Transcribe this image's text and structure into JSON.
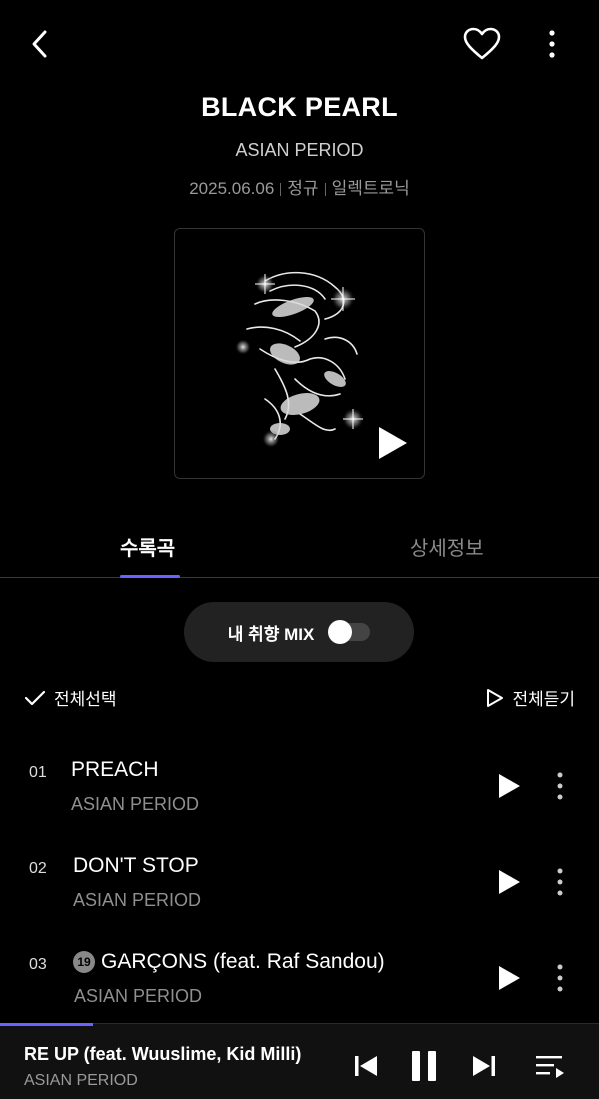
{
  "header": {
    "back_icon": "chevron-left-icon",
    "like_icon": "heart-outline-icon",
    "more_icon": "more-vertical-icon"
  },
  "album": {
    "title": "BLACK PEARL",
    "artist": "ASIAN PERIOD",
    "date": "2025.06.06",
    "type": "정규",
    "genre": "일렉트로닉"
  },
  "tabs": [
    {
      "label": "수록곡",
      "active": true
    },
    {
      "label": "상세정보",
      "active": false
    }
  ],
  "mix": {
    "label": "내 취향 MIX",
    "enabled": false
  },
  "list_controls": {
    "select_all": "전체선택",
    "play_all": "전체듣기"
  },
  "tracks": [
    {
      "num": "01",
      "title": "PREACH",
      "artist": "ASIAN PERIOD",
      "explicit": false
    },
    {
      "num": "02",
      "title": "DON'T STOP",
      "artist": "ASIAN PERIOD",
      "explicit": false
    },
    {
      "num": "03",
      "title": "GARÇONS (feat. Raf Sandou)",
      "artist": "ASIAN PERIOD",
      "explicit": true,
      "badge": "19"
    }
  ],
  "player": {
    "title": "RE UP (feat. Wuuslime, Kid Milli)",
    "artist": "ASIAN PERIOD",
    "progress": 0.155,
    "state": "playing"
  },
  "colors": {
    "accent": "#6a63ff",
    "background": "#000000",
    "muted_text": "#8f8f8f"
  }
}
